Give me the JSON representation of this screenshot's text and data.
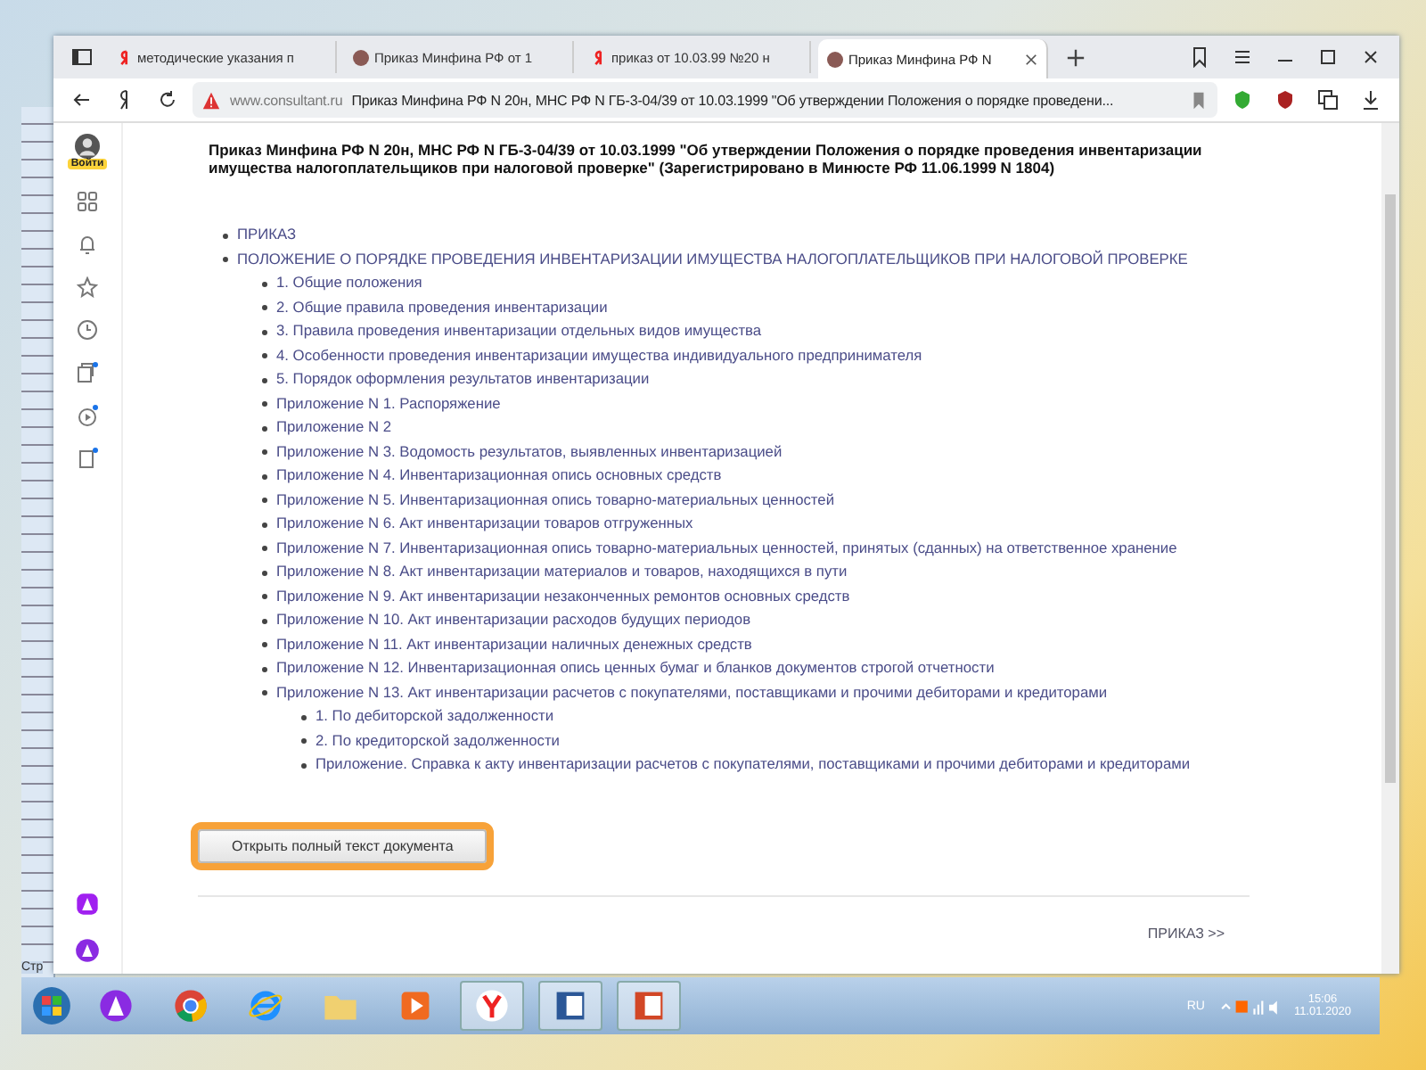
{
  "tabs": [
    {
      "label": "методические указания п",
      "kind": "search",
      "selected": false
    },
    {
      "label": "Приказ Минфина РФ от 1",
      "kind": "site",
      "selected": false
    },
    {
      "label": "приказ от 10.03.99 №20 н",
      "kind": "search",
      "selected": false
    },
    {
      "label": "Приказ Минфина РФ N",
      "kind": "site",
      "selected": true
    }
  ],
  "address": {
    "domain": "www.consultant.ru",
    "title": "Приказ Минфина РФ N 20н, МНС РФ N ГБ-3-04/39 от 10.03.1999 \"Об утверждении Положения о порядке проведени..."
  },
  "sidebar": {
    "login_label": "Войти"
  },
  "document": {
    "title": "Приказ Минфина РФ N 20н, МНС РФ N ГБ-3-04/39 от 10.03.1999 \"Об утверждении Положения о порядке проведения инвентаризации имущества налогоплательщиков при налоговой проверке\" (Зарегистрировано в Минюсте РФ 11.06.1999 N 1804)",
    "toc": [
      {
        "text": "ПРИКАЗ"
      },
      {
        "text": "ПОЛОЖЕНИЕ О ПОРЯДКЕ ПРОВЕДЕНИЯ ИНВЕНТАРИЗАЦИИ ИМУЩЕСТВА НАЛОГОПЛАТЕЛЬЩИКОВ ПРИ НАЛОГОВОЙ ПРОВЕРКЕ",
        "children": [
          {
            "text": "1. Общие положения"
          },
          {
            "text": "2. Общие правила проведения инвентаризации"
          },
          {
            "text": "3. Правила проведения инвентаризации отдельных видов имущества"
          },
          {
            "text": "4. Особенности проведения инвентаризации имущества индивидуального предпринимателя"
          },
          {
            "text": "5. Порядок оформления результатов инвентаризации"
          },
          {
            "text": "Приложение N 1. Распоряжение"
          },
          {
            "text": "Приложение N 2"
          },
          {
            "text": "Приложение N 3. Водомость результатов, выявленных инвентаризацией"
          },
          {
            "text": "Приложение N 4. Инвентаризационная опись основных средств"
          },
          {
            "text": "Приложение N 5. Инвентаризационная опись товарно-материальных ценностей"
          },
          {
            "text": "Приложение N 6. Акт инвентаризации товаров отгруженных"
          },
          {
            "text": "Приложение N 7. Инвентаризационная опись товарно-материальных ценностей, принятых (сданных) на ответственное хранение"
          },
          {
            "text": "Приложение N 8. Акт инвентаризации материалов и товаров, находящихся в пути"
          },
          {
            "text": "Приложение N 9. Акт инвентаризации незаконченных ремонтов основных средств"
          },
          {
            "text": "Приложение N 10. Акт инвентаризации расходов будущих периодов"
          },
          {
            "text": "Приложение N 11. Акт инвентаризации наличных денежных средств"
          },
          {
            "text": "Приложение N 12. Инвентаризационная опись ценных бумаг и бланков документов строгой отчетности"
          },
          {
            "text": "Приложение N 13. Акт инвентаризации расчетов с покупателями, поставщиками и прочими дебиторами и кредиторами",
            "children": [
              {
                "text": "1. По дебиторской задолженности"
              },
              {
                "text": "2. По кредиторской задолженности"
              },
              {
                "text": "Приложение. Справка к акту инвентаризации расчетов с покупателями, поставщиками и прочими дебиторами и кредиторами"
              }
            ]
          }
        ]
      }
    ],
    "open_button": "Открыть полный текст документа",
    "next_link": "ПРИКАЗ >>"
  },
  "word_status": "Стр",
  "taskbar": {
    "language": "RU",
    "time": "15:06",
    "date": "11.01.2020"
  }
}
